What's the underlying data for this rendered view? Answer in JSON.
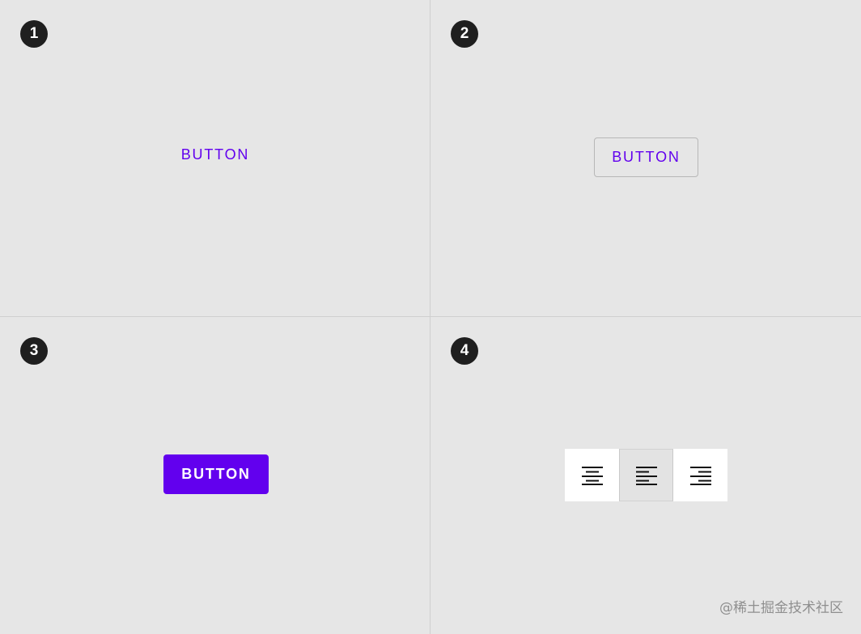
{
  "panels": [
    {
      "number": "1",
      "button_label": "BUTTON"
    },
    {
      "number": "2",
      "button_label": "BUTTON"
    },
    {
      "number": "3",
      "button_label": "BUTTON"
    },
    {
      "number": "4"
    }
  ],
  "toggle_group": {
    "items": [
      {
        "icon": "format-align-center-icon",
        "selected": false
      },
      {
        "icon": "format-align-left-icon",
        "selected": true
      },
      {
        "icon": "format-align-right-icon",
        "selected": false
      }
    ]
  },
  "colors": {
    "accent": "#6200ee",
    "background": "#e6e6e6",
    "badge": "#1f1f1f"
  },
  "watermark": "@稀土掘金技术社区"
}
